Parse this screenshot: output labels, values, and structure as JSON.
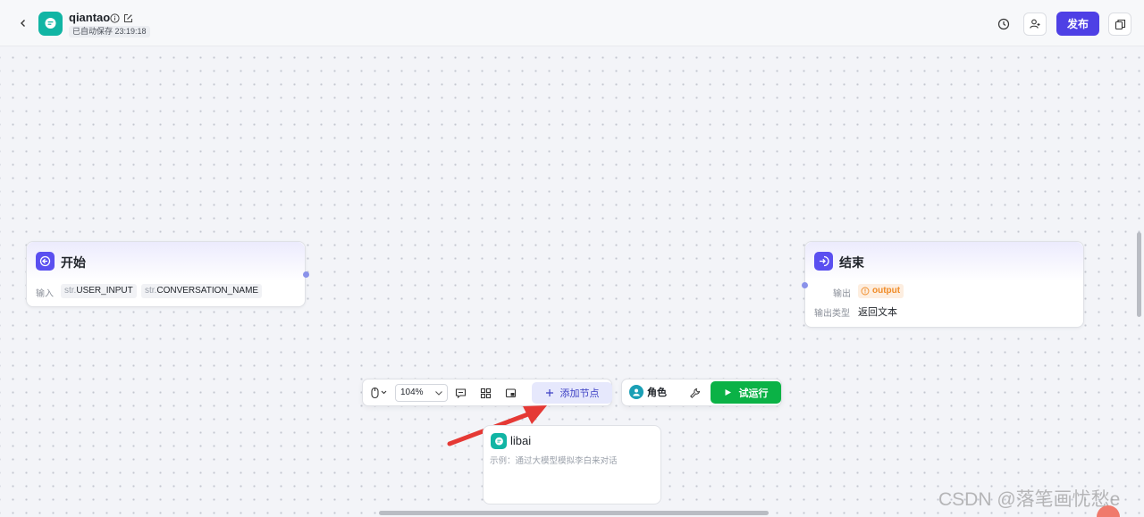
{
  "header": {
    "title": "qiantao",
    "autosave": "已自动保存 23:19:18",
    "publish_label": "发布"
  },
  "nodes": {
    "start": {
      "title": "开始",
      "input_label": "输入",
      "inputs": [
        {
          "type": "str.",
          "name": "USER_INPUT"
        },
        {
          "type": "str.",
          "name": "CONVERSATION_NAME"
        }
      ]
    },
    "end": {
      "title": "结束",
      "output_label": "输出",
      "output_value": "output",
      "output_type_label": "输出类型",
      "output_type_value": "返回文本"
    }
  },
  "toolbar": {
    "zoom": "104%",
    "add_node_label": "添加节点",
    "role_label": "角色",
    "run_label": "试运行"
  },
  "libai": {
    "name": "libai",
    "description": "示例：通过大模型模拟李白来对话"
  },
  "watermark": "CSDN @落笔画忧愁e",
  "colors": {
    "accent": "#4e40e5",
    "app_logo": "#11b5a4",
    "run_button": "#0bb246",
    "warning": "#f08c28",
    "arrow": "#e53935"
  }
}
